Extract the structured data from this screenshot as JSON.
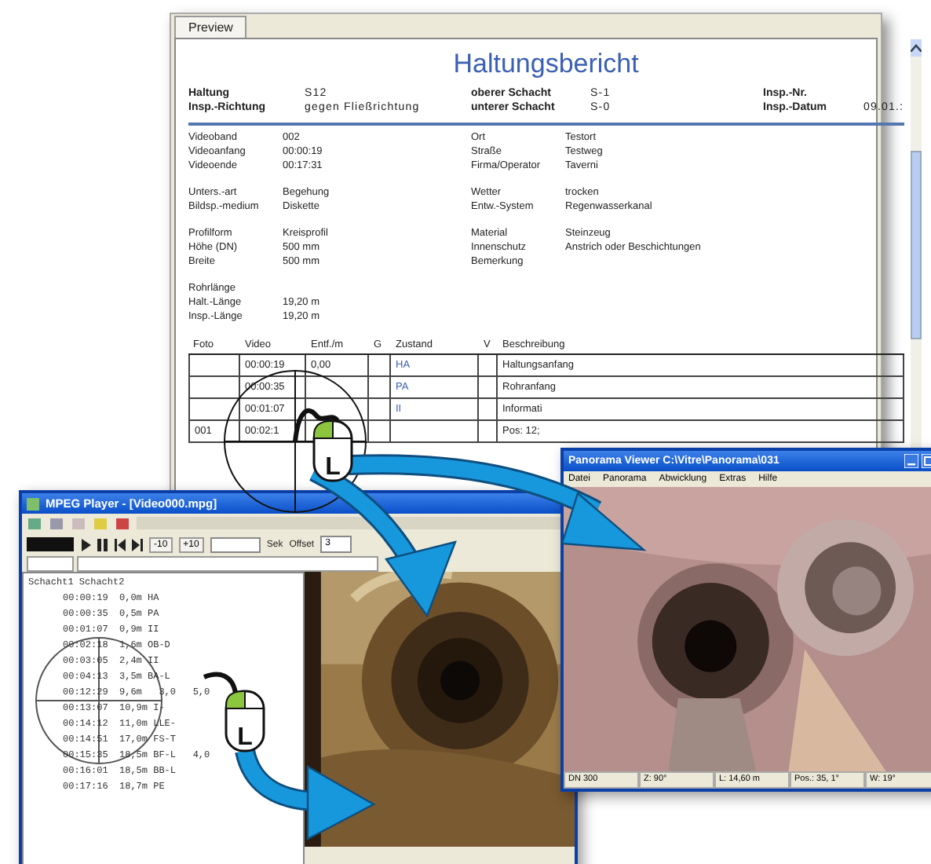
{
  "report": {
    "tab": "Preview",
    "title": "Haltungsbericht",
    "header": [
      [
        {
          "label": "Haltung",
          "value": "S12"
        },
        {
          "label": "oberer Schacht",
          "value": "S-1"
        },
        {
          "label": "Insp.-Nr."
        }
      ],
      [
        {
          "label": "Insp.-Richtung",
          "value": "gegen Fließrichtung"
        },
        {
          "label": "unterer Schacht",
          "value": "S-0"
        },
        {
          "label": "Insp.-Datum",
          "value": "09.01.:"
        }
      ]
    ],
    "groups": [
      [
        [
          {
            "label": "Videoband",
            "value": "002"
          },
          {
            "label": "Ort",
            "value": "Testort"
          }
        ],
        [
          {
            "label": "Videoanfang",
            "value": "00:00:19"
          },
          {
            "label": "Straße",
            "value": "Testweg"
          }
        ],
        [
          {
            "label": "Videoende",
            "value": "00:17:31"
          },
          {
            "label": "Firma/Operator",
            "value": "Taverni"
          }
        ]
      ],
      [
        [
          {
            "label": "Unters.-art",
            "value": "Begehung"
          },
          {
            "label": "Wetter",
            "value": "trocken"
          }
        ],
        [
          {
            "label": "Bildsp.-medium",
            "value": "Diskette"
          },
          {
            "label": "Entw.-System",
            "value": "Regenwasserkanal"
          }
        ]
      ],
      [
        [
          {
            "label": "Profilform",
            "value": "Kreisprofil"
          },
          {
            "label": "Material",
            "value": "Steinzeug"
          }
        ],
        [
          {
            "label": "Höhe (DN)",
            "value": "500 mm"
          },
          {
            "label": "Innenschutz",
            "value": "Anstrich oder Beschichtungen"
          }
        ],
        [
          {
            "label": "Breite",
            "value": "500 mm"
          },
          {
            "label": "Bemerkung"
          }
        ]
      ],
      [
        [
          {
            "label": "Rohrlänge"
          }
        ],
        [
          {
            "label": "Halt.-Länge",
            "value": "19,20 m"
          }
        ],
        [
          {
            "label": "Insp.-Länge",
            "value": "19,20 m"
          }
        ]
      ]
    ],
    "table": {
      "columns": [
        "Foto",
        "Video",
        "Entf./m",
        "G",
        "Zustand",
        "V",
        "Beschreibung"
      ],
      "rows": [
        [
          "",
          "00:00:19",
          "0,00",
          "",
          "HA",
          "",
          "Haltungsanfang"
        ],
        [
          "",
          "00:00:35",
          "",
          "",
          "PA",
          "",
          "Rohranfang"
        ],
        [
          "",
          "00:01:07",
          "",
          "",
          "II",
          "",
          "Informati"
        ],
        [
          "001",
          "00:02:1",
          "",
          "",
          "",
          "",
          "Pos: 12;"
        ]
      ]
    }
  },
  "player": {
    "title": "MPEG Player - [Video000.mpg]",
    "buttons": [
      "-10",
      "+10"
    ],
    "seconds_label": "Sek",
    "offset_label": "Offset",
    "offset_value": "3",
    "list_header": "Schacht1 Schacht2",
    "entries": [
      {
        "time": "00:00:19",
        "dist": "0,0m",
        "code": "HA"
      },
      {
        "time": "00:00:35",
        "dist": "0,5m",
        "code": "PA"
      },
      {
        "time": "00:01:07",
        "dist": "0,9m",
        "code": "II"
      },
      {
        "time": "00:02:18",
        "dist": "1,6m",
        "code": "OB-D"
      },
      {
        "time": "00:03:05",
        "dist": "2,4m",
        "code": "II"
      },
      {
        "time": "00:04:13",
        "dist": "3,5m",
        "code": "BA-L"
      },
      {
        "time": "00:12:29",
        "dist": "9,6m",
        "extra": "3,0   5,0"
      },
      {
        "time": "00:13:07",
        "dist": "10,9m",
        "code": "I-"
      },
      {
        "time": "00:14:12",
        "dist": "11,0m",
        "code": "LLE-"
      },
      {
        "time": "00:14:51",
        "dist": "17,0m",
        "code": "FS-T"
      },
      {
        "time": "00:15:35",
        "dist": "18,5m",
        "code": "BF-L",
        "extra": "4,0"
      },
      {
        "time": "00:16:01",
        "dist": "18,5m",
        "code": "BB-L"
      },
      {
        "time": "00:17:16",
        "dist": "18,7m",
        "code": "PE"
      }
    ]
  },
  "panorama": {
    "title": "Panorama Viewer  C:\\Vitre\\Panorama\\031",
    "menu": [
      "Datei",
      "Panorama",
      "Abwicklung",
      "Extras",
      "Hilfe"
    ],
    "status": [
      "DN 300",
      "Z: 90°",
      "L: 14,60 m",
      "Pos.: 35, 1°",
      "W: 19°"
    ]
  },
  "mouse_labels": [
    "L",
    "L"
  ]
}
